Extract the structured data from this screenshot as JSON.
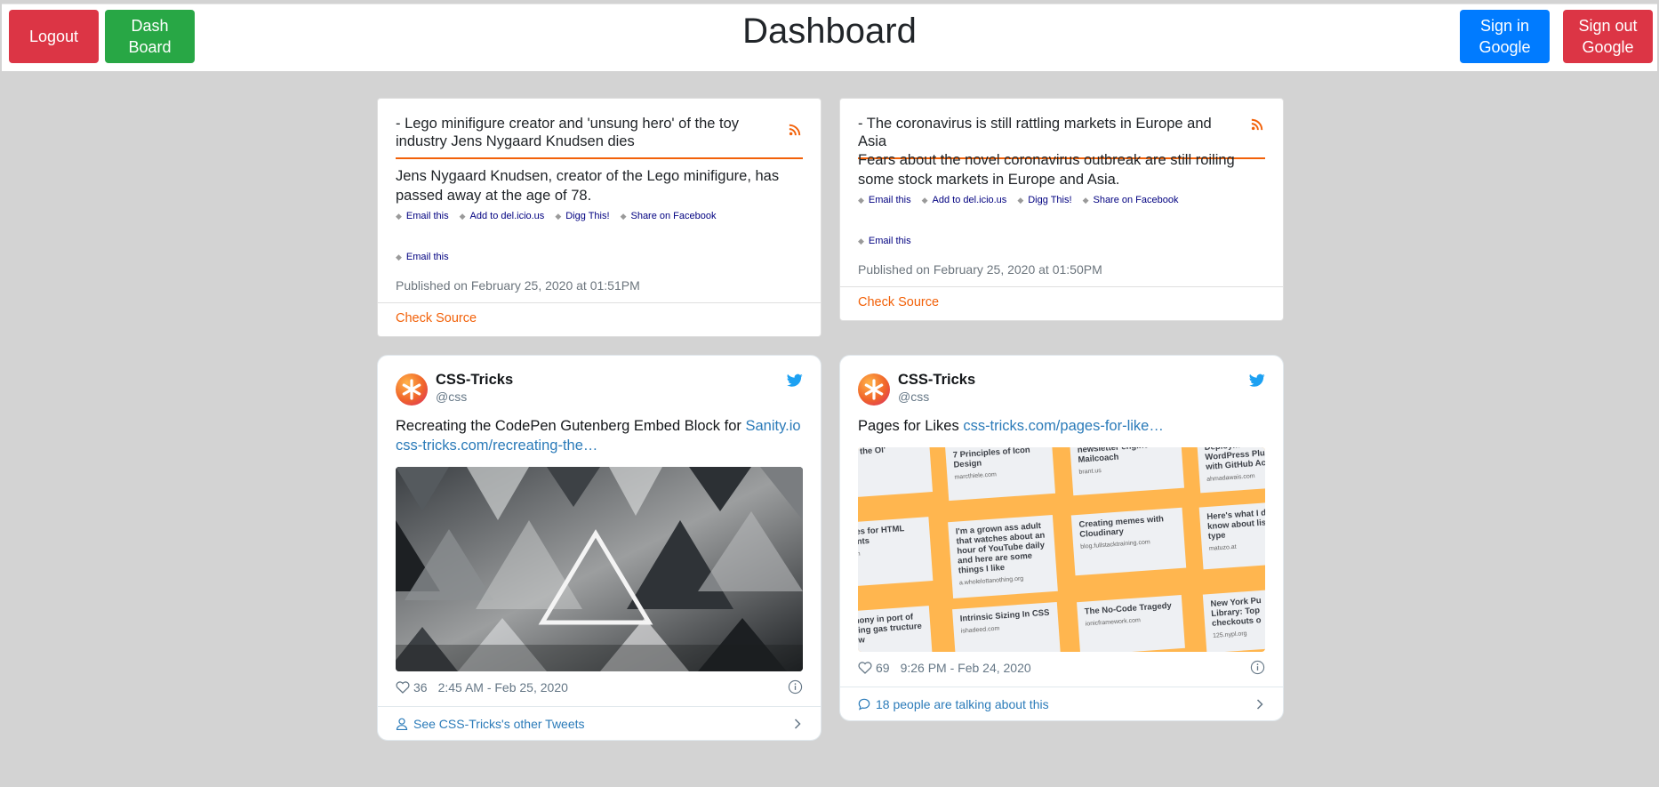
{
  "header": {
    "title": "Dashboard",
    "logout_label": "Logout",
    "dashboard_label": "Dash\nBoard",
    "sign_in_label": "Sign in\nGoogle",
    "sign_out_label": "Sign out\nGoogle"
  },
  "colors": {
    "background": "#d3d3d3",
    "danger": "#dc3545",
    "success": "#28a745",
    "primary": "#007bff",
    "rss_orange": "#f26109",
    "twitter_blue": "#1da1f2",
    "link_blue": "#2b7bb9"
  },
  "rss_items": [
    {
      "title": "- Lego minifigure creator and 'unsung hero' of the toy industry Jens Nygaard Knudsen dies",
      "description": "Jens Nygaard Knudsen, creator of the Lego minifigure, has passed away at the age of 78.",
      "share_links": [
        "Email this",
        "Add to del.icio.us",
        "Digg This!",
        "Share on Facebook"
      ],
      "extra_link": "Email this",
      "published": "Published on February 25, 2020 at 01:51PM",
      "footer_link": "Check Source",
      "icon": "rss-icon"
    },
    {
      "title": "- The coronavirus is still rattling markets in Europe and Asia",
      "description": "Fears about the novel coronavirus outbreak are still roiling some stock markets in Europe and Asia.",
      "share_links": [
        "Email this",
        "Add to del.icio.us",
        "Digg This!",
        "Share on Facebook"
      ],
      "extra_link": "Email this",
      "published": "Published on February 25, 2020 at 01:50PM",
      "footer_link": "Check Source",
      "icon": "rss-icon"
    }
  ],
  "tweets": [
    {
      "author": "CSS-Tricks",
      "handle": "@css",
      "text": "Recreating the CodePen Gutenberg Embed Block for ",
      "link1": "Sanity.io",
      "link2": "css-tricks.com/recreating-the…",
      "likes": "36",
      "time": "2:45 AM - Feb 25, 2020",
      "footer": "See CSS-Tricks's other Tweets",
      "image": "dark-triangle-mountain-artwork"
    },
    {
      "author": "CSS-Tricks",
      "handle": "@css",
      "text": "Pages for Likes ",
      "link1": "css-tricks.com/pages-for-like…",
      "likes": "69",
      "time": "9:26 PM - Feb 24, 2020",
      "footer": "18 people are talking about this",
      "image": "link-cards-grid",
      "tiles": [
        {
          "t": "ts on the Ol'",
          "s": ""
        },
        {
          "t": "7 Principles of Icon Design",
          "s": "marcthiele.com"
        },
        {
          "t": "newsletter engine with Mailcoach",
          "s": "brant.us"
        },
        {
          "t": "Deployment for WordPress Plug with GitHub Act",
          "s": "ahmadawais.com"
        },
        {
          "t": "ributes for HTML lements",
          "s": "ing.com"
        },
        {
          "t": "I'm a grown ass adult that watches about an hour of YouTube daily and here are some things I like",
          "s": "a.wholelottanothing.org"
        },
        {
          "t": "Creating memes with Cloudinary",
          "s": "blog.fullstacktraining.com"
        },
        {
          "t": "Here's what I d know about lis type",
          "s": "matuzo.at"
        },
        {
          "t": "estimony in port of banning gas tructure in new",
          "s": ""
        },
        {
          "t": "Intrinsic Sizing In CSS",
          "s": "ishadeed.com"
        },
        {
          "t": "The No-Code Tragedy",
          "s": "ionicframework.com"
        },
        {
          "t": "New York Pu Library: Top checkouts o",
          "s": "125.nypl.org"
        }
      ]
    }
  ]
}
